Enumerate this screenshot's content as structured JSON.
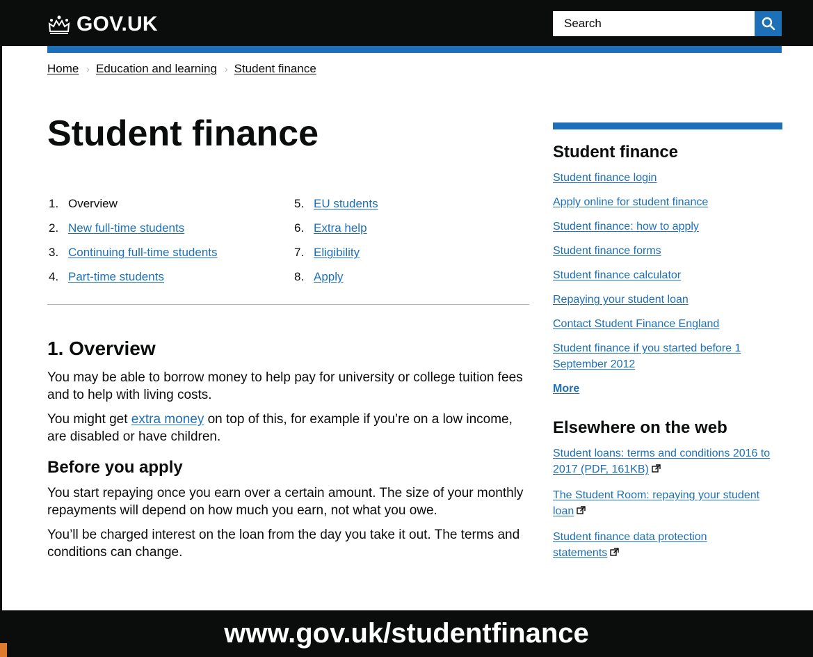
{
  "header": {
    "logo_text": "GOV.UK",
    "search_placeholder": "Search"
  },
  "breadcrumb": [
    {
      "label": "Home"
    },
    {
      "label": "Education and learning"
    },
    {
      "label": "Student finance"
    }
  ],
  "page_title": "Student finance",
  "contents": {
    "left": [
      {
        "num": "1.",
        "label": "Overview",
        "current": true
      },
      {
        "num": "2.",
        "label": "New full-time students"
      },
      {
        "num": "3.",
        "label": "Continuing full-time students"
      },
      {
        "num": "4.",
        "label": "Part-time students"
      }
    ],
    "right": [
      {
        "num": "5.",
        "label": "EU students"
      },
      {
        "num": "6.",
        "label": "Extra help"
      },
      {
        "num": "7.",
        "label": "Eligibility"
      },
      {
        "num": "8.",
        "label": "Apply"
      }
    ]
  },
  "main": {
    "section_heading": "1. Overview",
    "p1": "You may be able to borrow money to help pay for university or college tuition fees and to help with living costs.",
    "p2_before": "You might get ",
    "p2_link": "extra money",
    "p2_after": " on top of this, for example if you’re on a low income, are disabled or have children.",
    "subheading": "Before you apply",
    "p3": "You start repaying once you earn over a certain amount. The size of your monthly repayments will depend on how much you earn, not what you owe.",
    "p4": "You’ll be charged interest on the loan from the day you take it out. The terms and conditions can change."
  },
  "sidebar": {
    "title": "Student finance",
    "links": [
      "Student finance login",
      "Apply online for student finance",
      "Student finance: how to apply",
      "Student finance forms",
      "Student finance calculator",
      "Repaying your student loan",
      "Contact Student Finance England",
      "Student finance if you started before 1 September 2012"
    ],
    "more": "More",
    "elsewhere_title": "Elsewhere on the web",
    "external_links": [
      "Student loans: terms and conditions 2016 to 2017 (PDF, 161KB)",
      "The Student Room: repaying your student loan",
      "Student finance data protection statements"
    ]
  },
  "banner": "www.gov.uk/studentfinance",
  "colors": {
    "header_bg": "#0b0c0c",
    "brand_blue": "#1d70b8",
    "text": "#0b0c0c",
    "rule": "#b1b4b6"
  }
}
